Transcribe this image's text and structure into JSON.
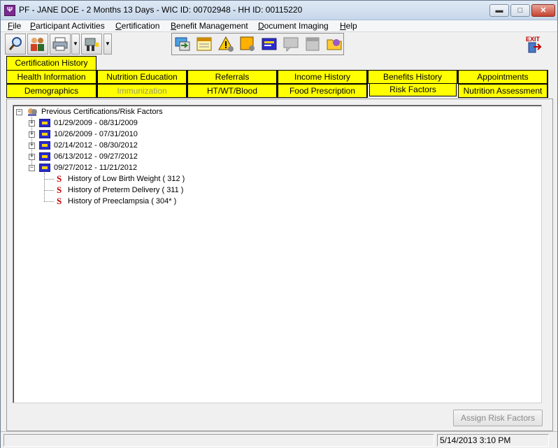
{
  "window": {
    "title": "PF - JANE DOE - 2 Months 13 Days - WIC ID: 00702948 - HH ID: 00115220",
    "app_icon_glyph": "Ψ",
    "minimize_glyph": "▬",
    "maximize_glyph": "□",
    "close_glyph": "✕"
  },
  "menu": [
    {
      "label": "File",
      "mnemonic": "F",
      "rest": "ile"
    },
    {
      "label": "Participant Activities",
      "mnemonic": "P",
      "rest": "articipant Activities"
    },
    {
      "label": "Certification",
      "mnemonic": "C",
      "rest": "ertification"
    },
    {
      "label": "Benefit Management",
      "mnemonic": "B",
      "rest": "enefit Management"
    },
    {
      "label": "Document Imaging",
      "mnemonic": "D",
      "rest": "ocument Imaging"
    },
    {
      "label": "Help",
      "mnemonic": "H",
      "rest": "elp"
    }
  ],
  "toolbar": {
    "icons": [
      "search-icon",
      "family-icon",
      "printer-icon",
      "scale-icon",
      "transfer-icon",
      "calendar-icon",
      "alert-icon",
      "note-icon",
      "certificate-icon",
      "message-icon",
      "document-icon",
      "folder-icon",
      "exit-icon"
    ],
    "exit_label": "EXIT",
    "dropdown_glyph": "▼"
  },
  "tabs": {
    "top": "Certification History",
    "row1": [
      "Health Information",
      "Nutrition Education",
      "Referrals",
      "Income History",
      "Benefits History",
      "Appointments"
    ],
    "row2": [
      "Demographics",
      "Immunization",
      "HT/WT/Blood",
      "Food Prescription",
      "Risk Factors",
      "Nutrition Assessment"
    ],
    "selected": "Risk Factors",
    "disabled": [
      "Immunization"
    ]
  },
  "tree": {
    "root": "Previous Certifications/Risk Factors",
    "expand_glyph": "+",
    "collapse_glyph": "−",
    "certifications": [
      {
        "range": "01/29/2009 - 08/31/2009",
        "expanded": false
      },
      {
        "range": "10/26/2009 - 07/31/2010",
        "expanded": false
      },
      {
        "range": "02/14/2012 - 08/30/2012",
        "expanded": false
      },
      {
        "range": "06/13/2012 - 09/27/2012",
        "expanded": false
      },
      {
        "range": "09/27/2012 - 11/21/2012",
        "expanded": true
      }
    ],
    "risk_glyph": "S",
    "risk_factors": [
      "History of Low Birth Weight ( 312 )",
      "History of Preterm Delivery ( 311 )",
      "History of Preeclampsia ( 304* )"
    ]
  },
  "buttons": {
    "assign_risk_factors": "Assign Risk Factors"
  },
  "status": {
    "datetime": "5/14/2013  3:10 PM"
  },
  "colors": {
    "tab_yellow": "#ffff00",
    "risk_red": "#c00000",
    "cert_blue": "#2b2bd0"
  }
}
